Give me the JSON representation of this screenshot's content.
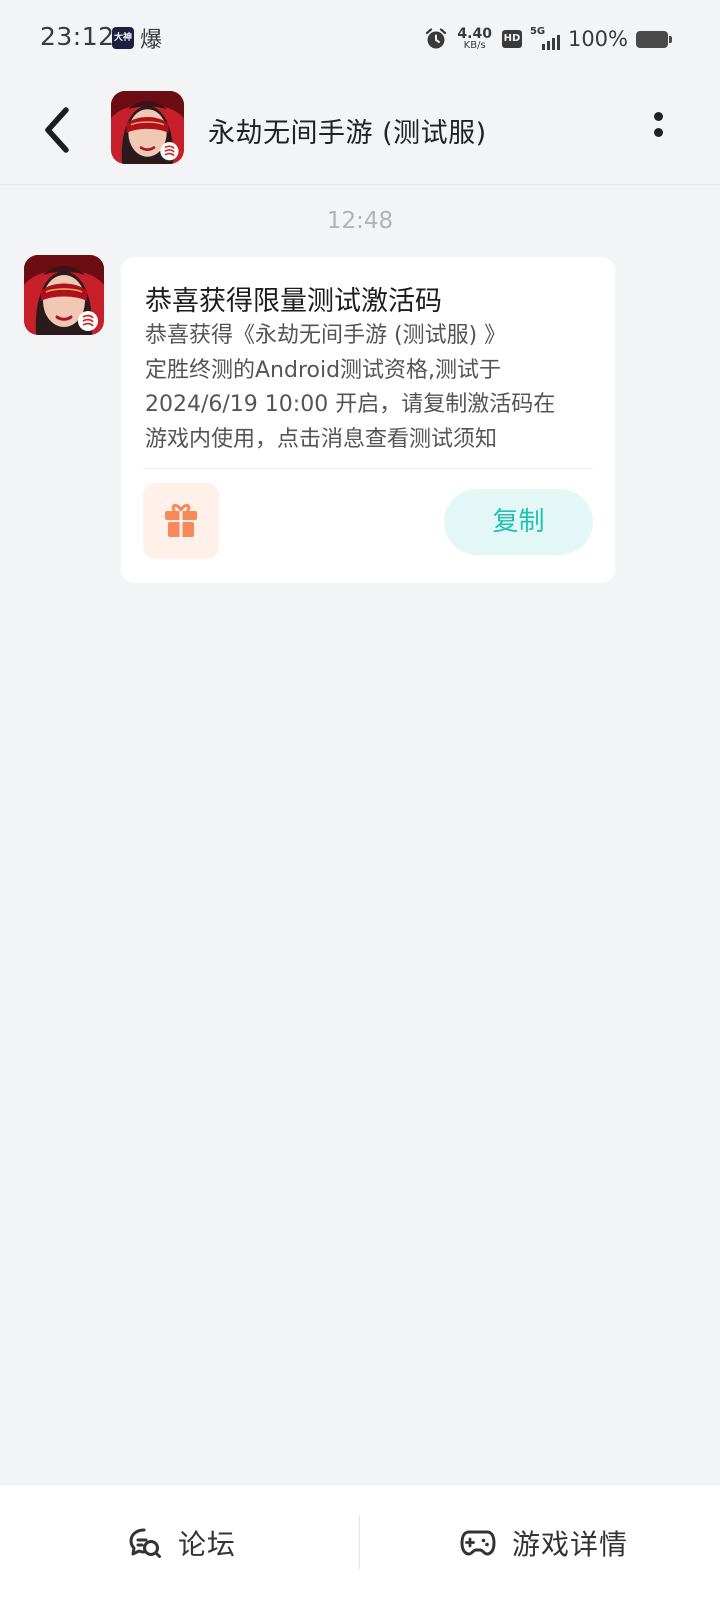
{
  "status_bar": {
    "time": "23:12",
    "app_badge": "大神",
    "extra_glyph": "爆",
    "net_speed_value": "4.40",
    "net_speed_unit": "KB/s",
    "hd": "HD",
    "network": "5G",
    "battery": "100%"
  },
  "header": {
    "title": "永劫无间手游 (测试服)",
    "back_icon": "chevron-left-icon",
    "more_icon": "vertical-dots-icon"
  },
  "chat": {
    "timestamp": "12:48",
    "message": {
      "title": "恭喜获得限量测试激活码",
      "body_lines": [
        "恭喜获得《永劫无间手游 (测试服) 》",
        "定胜终测的Android测试资格,测试于",
        "2024/6/19 10:00 开启，请复制激活码在",
        "游戏内使用，点击消息查看测试须知"
      ],
      "gift_icon": "gift-icon",
      "copy_label": "复制"
    }
  },
  "bottom_nav": {
    "forum_label": "论坛",
    "details_label": "游戏详情"
  },
  "colors": {
    "background": "#f3f4f6",
    "accent": "#1fc2b5",
    "gift": "#f7895a"
  }
}
